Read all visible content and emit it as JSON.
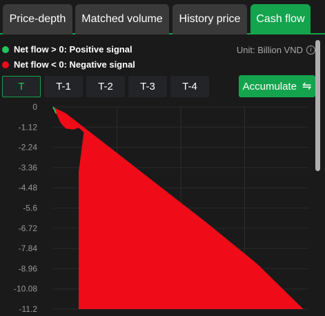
{
  "tabs": [
    {
      "label": "Price-depth"
    },
    {
      "label": "Matched volume"
    },
    {
      "label": "History price"
    },
    {
      "label": "Cash flow"
    }
  ],
  "legend": {
    "positive": {
      "text": "Net flow > 0: Positive signal",
      "color": "#22c55e"
    },
    "negative": {
      "text": "Net flow < 0: Negative signal",
      "color": "#ef0b18"
    }
  },
  "unit_label": "Unit: Billion VND",
  "info_icon": "info-icon",
  "time_buttons": [
    {
      "label": "T"
    },
    {
      "label": "T-1"
    },
    {
      "label": "T-2"
    },
    {
      "label": "T-3"
    },
    {
      "label": "T-4"
    }
  ],
  "active_time": "T",
  "accumulate": {
    "label": "Accumulate",
    "icon": "swap-arrows-icon",
    "glyph": "⇋"
  },
  "colors": {
    "accent": "#14a44d",
    "negative": "#ef0b18",
    "positive": "#22c55e"
  },
  "chart_data": {
    "type": "area",
    "y_ticks": [
      "0",
      "-1.12",
      "-2.24",
      "-3.36",
      "-4.48",
      "-5.6",
      "-6.72",
      "-7.84",
      "-8.96",
      "-10.08",
      "-11.2"
    ],
    "ylim": [
      -11.2,
      0
    ],
    "xlim": [
      0,
      1
    ],
    "grid": true,
    "series": [
      {
        "color": "#ef0b18",
        "points": [
          [
            0.0,
            0
          ],
          [
            0.01,
            -0.3
          ],
          [
            0.03,
            -0.9
          ],
          [
            0.05,
            -1.2
          ],
          [
            0.08,
            -1.25
          ],
          [
            0.1,
            -1.15
          ],
          [
            0.12,
            -1.4
          ],
          [
            0.1,
            -3.6
          ],
          [
            0.1,
            -11.2
          ],
          [
            0.3,
            -11.2
          ],
          [
            0.5,
            -11.2
          ],
          [
            0.75,
            -11.2
          ],
          [
            0.98,
            -11.2
          ],
          [
            0.8,
            -8.7
          ],
          [
            0.6,
            -6.4
          ],
          [
            0.4,
            -4.2
          ],
          [
            0.2,
            -2.0
          ],
          [
            0.05,
            -0.35
          ],
          [
            0.0,
            0
          ]
        ]
      }
    ]
  }
}
